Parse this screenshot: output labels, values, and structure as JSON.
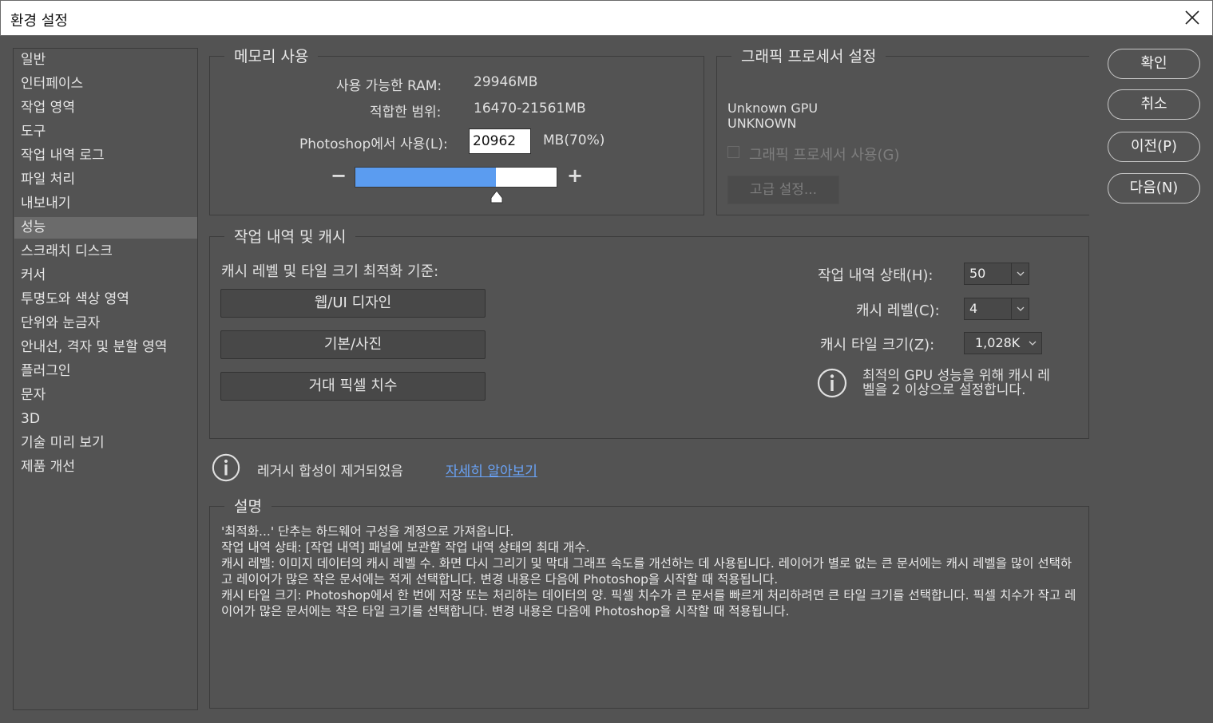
{
  "window": {
    "title": "환경 설정"
  },
  "sidebar": {
    "items": [
      {
        "label": "일반"
      },
      {
        "label": "인터페이스"
      },
      {
        "label": "작업 영역"
      },
      {
        "label": "도구"
      },
      {
        "label": "작업 내역 로그"
      },
      {
        "label": "파일 처리"
      },
      {
        "label": "내보내기"
      },
      {
        "label": "성능",
        "active": true
      },
      {
        "label": "스크래치 디스크"
      },
      {
        "label": "커서"
      },
      {
        "label": "투명도와 색상 영역"
      },
      {
        "label": "단위와 눈금자"
      },
      {
        "label": "안내선, 격자 및 분할 영역"
      },
      {
        "label": "플러그인"
      },
      {
        "label": "문자"
      },
      {
        "label": "3D"
      },
      {
        "label": "기술 미리 보기"
      },
      {
        "label": "제품 개선"
      }
    ]
  },
  "memory": {
    "legend": "메모리 사용",
    "available_label": "사용 가능한 RAM:",
    "available_value": "29946MB",
    "ideal_label": "적합한 범위:",
    "ideal_value": "16470-21561MB",
    "use_label": "Photoshop에서 사용(L):",
    "use_value": "20962",
    "use_unit": "MB(70%)",
    "slider_percent": 70,
    "minus": "−",
    "plus": "+"
  },
  "gpu": {
    "legend": "그래픽 프로세서 설정",
    "name_line1": "Unknown GPU",
    "name_line2": "UNKNOWN",
    "use_gpu_label": "그래픽 프로세서 사용(G)",
    "advanced_label": "고급 설정..."
  },
  "history_cache": {
    "legend": "작업 내역 및 캐시",
    "optimize_label": "캐시 레벨 및 타일 크기 최적화 기준:",
    "presets": [
      "웹/UI 디자인",
      "기본/사진",
      "거대 픽셀 치수"
    ],
    "states_label": "작업 내역 상태(H):",
    "states_value": "50",
    "levels_label": "캐시 레벨(C):",
    "levels_value": "4",
    "tile_label": "캐시 타일 크기(Z):",
    "tile_value": "1,028K",
    "gpu_note_line1": "최적의 GPU 성능을 위해 캐시 레",
    "gpu_note_line2": "벨을 2 이상으로 설정합니다."
  },
  "legacy": {
    "text": "레거시 합성이 제거되었음",
    "link": "자세히 알아보기"
  },
  "description": {
    "legend": "설명",
    "lines": [
      "'최적화...' 단추는 하드웨어 구성을 계정으로 가져옵니다.",
      "작업 내역 상태: [작업 내역] 패널에 보관할 작업 내역 상태의 최대 개수.",
      "캐시 레벨: 이미지 데이터의 캐시 레벨 수. 화면 다시 그리기 및 막대 그래프 속도를 개선하는 데 사용됩니다. 레이어가 별로 없는 큰 문서에는 캐시 레벨을 많이 선택하고 레이어가 많은 작은 문서에는 적게 선택합니다. 변경 내용은 다음에 Photoshop을 시작할 때 적용됩니다.",
      "캐시 타일 크기: Photoshop에서 한 번에 저장 또는 처리하는 데이터의 양. 픽셀 치수가 큰 문서를 빠르게 처리하려면 큰 타일 크기를 선택합니다. 픽셀 치수가 작고 레이어가 많은 문서에는 작은 타일 크기를 선택합니다. 변경 내용은 다음에 Photoshop을 시작할 때 적용됩니다."
    ]
  },
  "buttons": {
    "ok": "확인",
    "cancel": "취소",
    "prev": "이전(P)",
    "next": "다음(N)"
  },
  "colors": {
    "panel": "#535353",
    "slider_fill": "#5b9cf0",
    "link": "#6aa3f7"
  }
}
